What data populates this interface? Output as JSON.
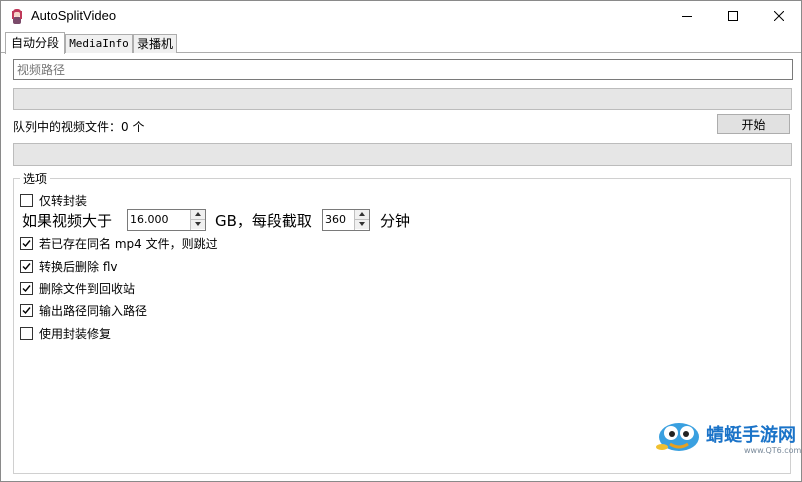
{
  "window": {
    "title": "AutoSplitVideo",
    "icon": "app-character-icon",
    "controls": [
      "minimize-icon",
      "maximize-icon",
      "close-icon"
    ]
  },
  "tabs": [
    {
      "label": "自动分段",
      "active": true
    },
    {
      "label": "MediaInfo",
      "active": false
    },
    {
      "label": "录播机",
      "active": false
    }
  ],
  "path_input": {
    "value": "",
    "placeholder": "视频路径"
  },
  "progress_top": {
    "value": 0
  },
  "queue": {
    "label": "队列中的视频文件：0 个"
  },
  "start_button": {
    "label": "开始"
  },
  "progress_bottom": {
    "value": 0
  },
  "options": {
    "group_title": "选项",
    "remux_only": {
      "label": "仅转封装",
      "checked": false
    },
    "split": {
      "prefix": "如果视频大于",
      "size_value": "16.000",
      "middle": "GB，每段截取",
      "minutes_value": "360",
      "suffix": "分钟"
    },
    "skip_existing": {
      "label": "若已存在同名 mp4 文件，则跳过",
      "checked": true
    },
    "delete_flv": {
      "label": "转换后删除 flv",
      "checked": true
    },
    "recycle_bin": {
      "label": "删除文件到回收站",
      "checked": true
    },
    "same_output": {
      "label": "输出路径同输入路径",
      "checked": true
    },
    "use_fix": {
      "label": "使用封装修复",
      "checked": false
    }
  },
  "watermark": {
    "brand": "蜻蜓手游网",
    "url": "www.QT6.com"
  },
  "colors": {
    "accent": "#1a73c8",
    "progress_bg": "#e6e6e6",
    "button_bg": "#e1e1e1"
  }
}
